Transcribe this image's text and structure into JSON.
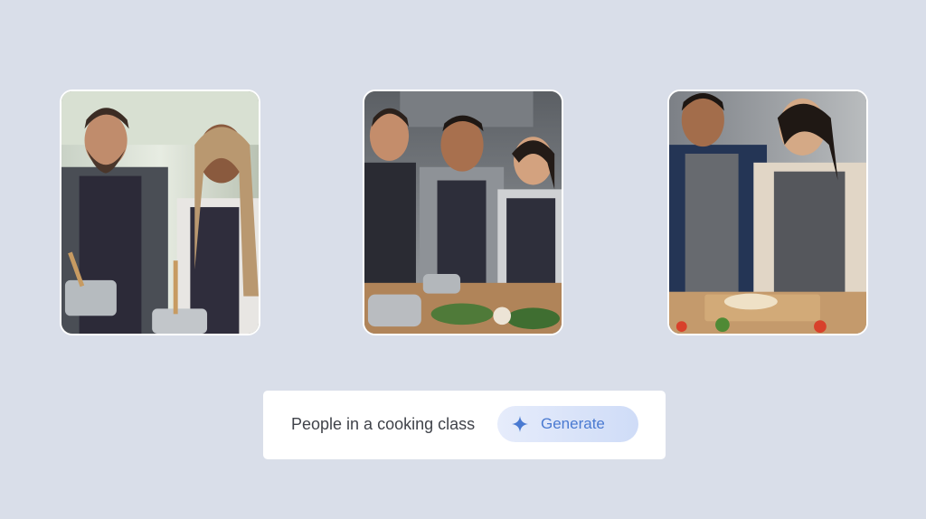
{
  "images": [
    {
      "subject": "two people laughing while cooking at a stove"
    },
    {
      "subject": "three people in aprons preparing vegetables at a table"
    },
    {
      "subject": "two people kneading dough at a cutting board"
    }
  ],
  "prompt": {
    "text": "People in a cooking class",
    "generate_label": "Generate",
    "icon": "sparkle-icon"
  },
  "colors": {
    "background": "#d9dee9",
    "accent": "#4a7ad1",
    "button_gradient_start": "#e6ecfb",
    "button_gradient_end": "#cfdcf7"
  }
}
